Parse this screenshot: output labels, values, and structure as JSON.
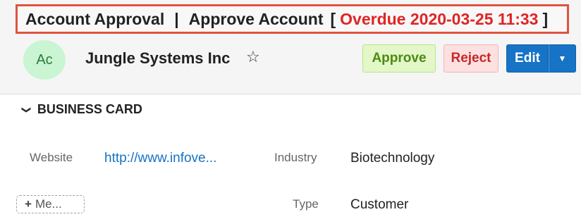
{
  "process": {
    "module": "Account Approval",
    "separator": "|",
    "step": "Approve Account",
    "bracket_open": "[",
    "overdue": "Overdue 2020-03-25 11:33",
    "bracket_close": "]"
  },
  "record": {
    "avatar_initials": "Ac",
    "name": "Jungle Systems Inc",
    "favorite_icon": "☆"
  },
  "actions": {
    "approve": "Approve",
    "reject": "Reject",
    "edit": "Edit",
    "caret": "▼"
  },
  "panel": {
    "chevron": "❯",
    "title": "BUSINESS CARD"
  },
  "fields": {
    "website_label": "Website",
    "website_value": "http://www.infove...",
    "industry_label": "Industry",
    "industry_value": "Biotechnology",
    "type_label": "Type",
    "type_value": "Customer"
  },
  "more": {
    "icon": "+",
    "label": "Me..."
  },
  "colors": {
    "overdue": "#e02424",
    "banner_border": "#e0533f",
    "avatar_bg": "#c9f5d2",
    "approve_bg": "#e3f7c8",
    "reject_bg": "#fde0e0",
    "edit_bg": "#1673c5",
    "link": "#1673c5"
  }
}
